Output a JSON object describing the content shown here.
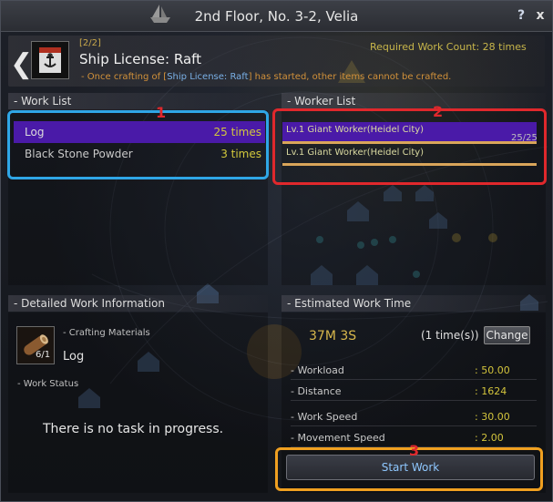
{
  "window": {
    "title": "2nd Floor, No. 3-2, Velia",
    "help_label": "?",
    "close_label": "x"
  },
  "header": {
    "count_text": "[2/2]",
    "item_name": "Ship License: Raft",
    "required_label": "Required Work Count: 28 times",
    "warning_prefix": "- Once crafting of [",
    "warning_item": "Ship License: Raft",
    "warning_suffix": "] has started, other items cannot be crafted."
  },
  "work_list": {
    "title": "- Work List",
    "items": [
      {
        "label": "Log",
        "times": "25 times"
      },
      {
        "label": "Black Stone Powder",
        "times": "3 times"
      }
    ]
  },
  "worker_list": {
    "title": "- Worker List",
    "count": "25/25",
    "items": [
      {
        "label": "Lv.1 Giant Worker(Heidel City)"
      },
      {
        "label": "Lv.1 Giant Worker(Heidel City)"
      }
    ]
  },
  "detail": {
    "title": "- Detailed Work Information",
    "materials_label": "- Crafting Materials",
    "material_name": "Log",
    "material_qty": "6/1",
    "status_label": "- Work Status",
    "status_text": "There is no task in progress."
  },
  "estimate": {
    "title": "- Estimated Work Time",
    "time": "37M 3S",
    "count": "(1 time(s))",
    "change_label": "Change",
    "stats": [
      {
        "label": "- Workload",
        "value": ": 50.00"
      },
      {
        "label": "- Distance",
        "value": ": 1624"
      },
      {
        "label": "- Work Speed",
        "value": ": 30.00"
      },
      {
        "label": "- Movement Speed",
        "value": ": 2.00"
      }
    ],
    "start_label": "Start Work"
  },
  "annotations": {
    "labels": [
      "1",
      "2",
      "3"
    ],
    "colors": {
      "1": "#2fa6e6",
      "2": "#e0282c",
      "3": "#f0a020"
    }
  },
  "colors": {
    "selection": "#4a1aa8",
    "times_yellow": "#d2c83c",
    "gold": "#d8b84c",
    "start_text": "#8fc8ff"
  }
}
